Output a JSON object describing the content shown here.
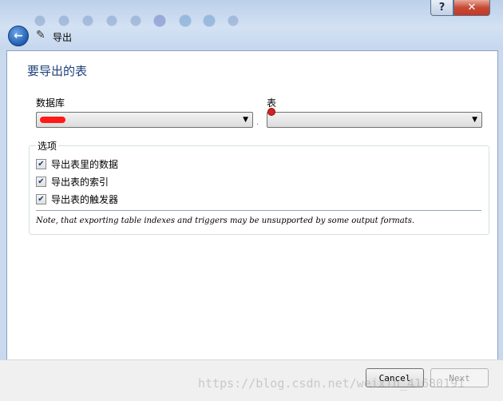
{
  "window": {
    "help_label": "?",
    "close_label": "✕",
    "wizard_title": "导出"
  },
  "page": {
    "title": "要导出的表",
    "database_label": "数据库",
    "table_label": "表",
    "database_value": "",
    "table_value": ""
  },
  "options": {
    "legend": "选项",
    "items": [
      {
        "label": "导出表里的数据",
        "checked": true
      },
      {
        "label": "导出表的索引",
        "checked": true
      },
      {
        "label": "导出表的触发器",
        "checked": true
      }
    ],
    "note": "Note, that exporting table indexes and triggers may be unsupported by some output formats."
  },
  "buttons": {
    "cancel": "Cancel",
    "next": "Next"
  },
  "watermark": "https://blog.csdn.net/weixin_41680191",
  "icons": {
    "back": "back-arrow-icon",
    "wizard": "wand-icon",
    "dropdown": "chevron-down-icon"
  },
  "colors": {
    "title_text": "#1e3f7a",
    "frame": "#c9d9ee"
  }
}
